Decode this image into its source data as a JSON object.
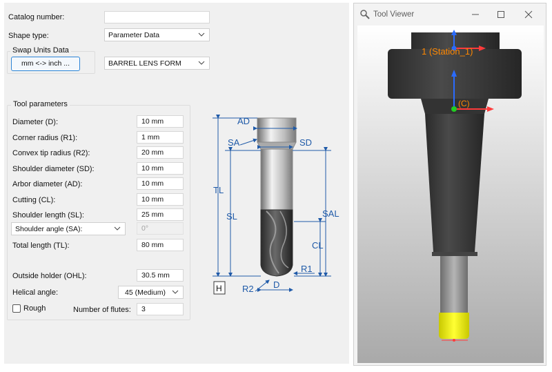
{
  "form": {
    "catalog_number_label": "Catalog number:",
    "catalog_number_value": "",
    "shape_type_label": "Shape type:",
    "shape_type_value": "Parameter Data",
    "swap_group_title": "Swap Units Data",
    "swap_button_label": "mm <-> inch ...",
    "form_select_value": "BARREL LENS FORM"
  },
  "tool_parameters": {
    "title": "Tool parameters",
    "diameter_label": "Diameter (D):",
    "diameter_value": "10 mm",
    "corner_radius_label": "Corner radius (R1):",
    "corner_radius_value": "1 mm",
    "convex_tip_label": "Convex tip radius (R2):",
    "convex_tip_value": "20 mm",
    "shoulder_diameter_label": "Shoulder diameter (SD):",
    "shoulder_diameter_value": "10 mm",
    "arbor_diameter_label": "Arbor diameter (AD):",
    "arbor_diameter_value": "10 mm",
    "cutting_label": "Cutting (CL):",
    "cutting_value": "10 mm",
    "shoulder_length_label": "Shoulder length (SL):",
    "shoulder_length_value": "25 mm",
    "shoulder_angle_select": "Shoulder angle (SA):",
    "shoulder_angle_value": "0°",
    "total_length_label": "Total length (TL):",
    "total_length_value": "80 mm",
    "outside_holder_label": "Outside holder (OHL):",
    "outside_holder_value": "30.5 mm",
    "helical_angle_label": "Helical angle:",
    "helical_angle_value": "45 (Medium)",
    "rough_label": "Rough",
    "rough_checked": false,
    "flutes_label": "Number of flutes:",
    "flutes_value": "3"
  },
  "diagram": {
    "labels": {
      "AD": "AD",
      "SA": "SA",
      "SD": "SD",
      "TL": "TL",
      "SL": "SL",
      "SAL": "SAL",
      "CL": "CL",
      "R1": "R1",
      "R2": "R2",
      "D": "D",
      "H": "H"
    }
  },
  "viewer": {
    "title": "Tool Viewer",
    "station_label": "1 (Station_1)",
    "c_label": "(C)",
    "colors": {
      "holder": "#3a3a3a",
      "shank": "#9a9a9a",
      "tip": "#e6e600",
      "label": "#ff8800",
      "axis_x": "#ff3b3b",
      "axis_y": "#2a6bff",
      "origin": "#22cc22"
    },
    "icons": [
      "tool-viewer-app-icon",
      "minimize-icon",
      "maximize-icon",
      "close-icon"
    ]
  }
}
